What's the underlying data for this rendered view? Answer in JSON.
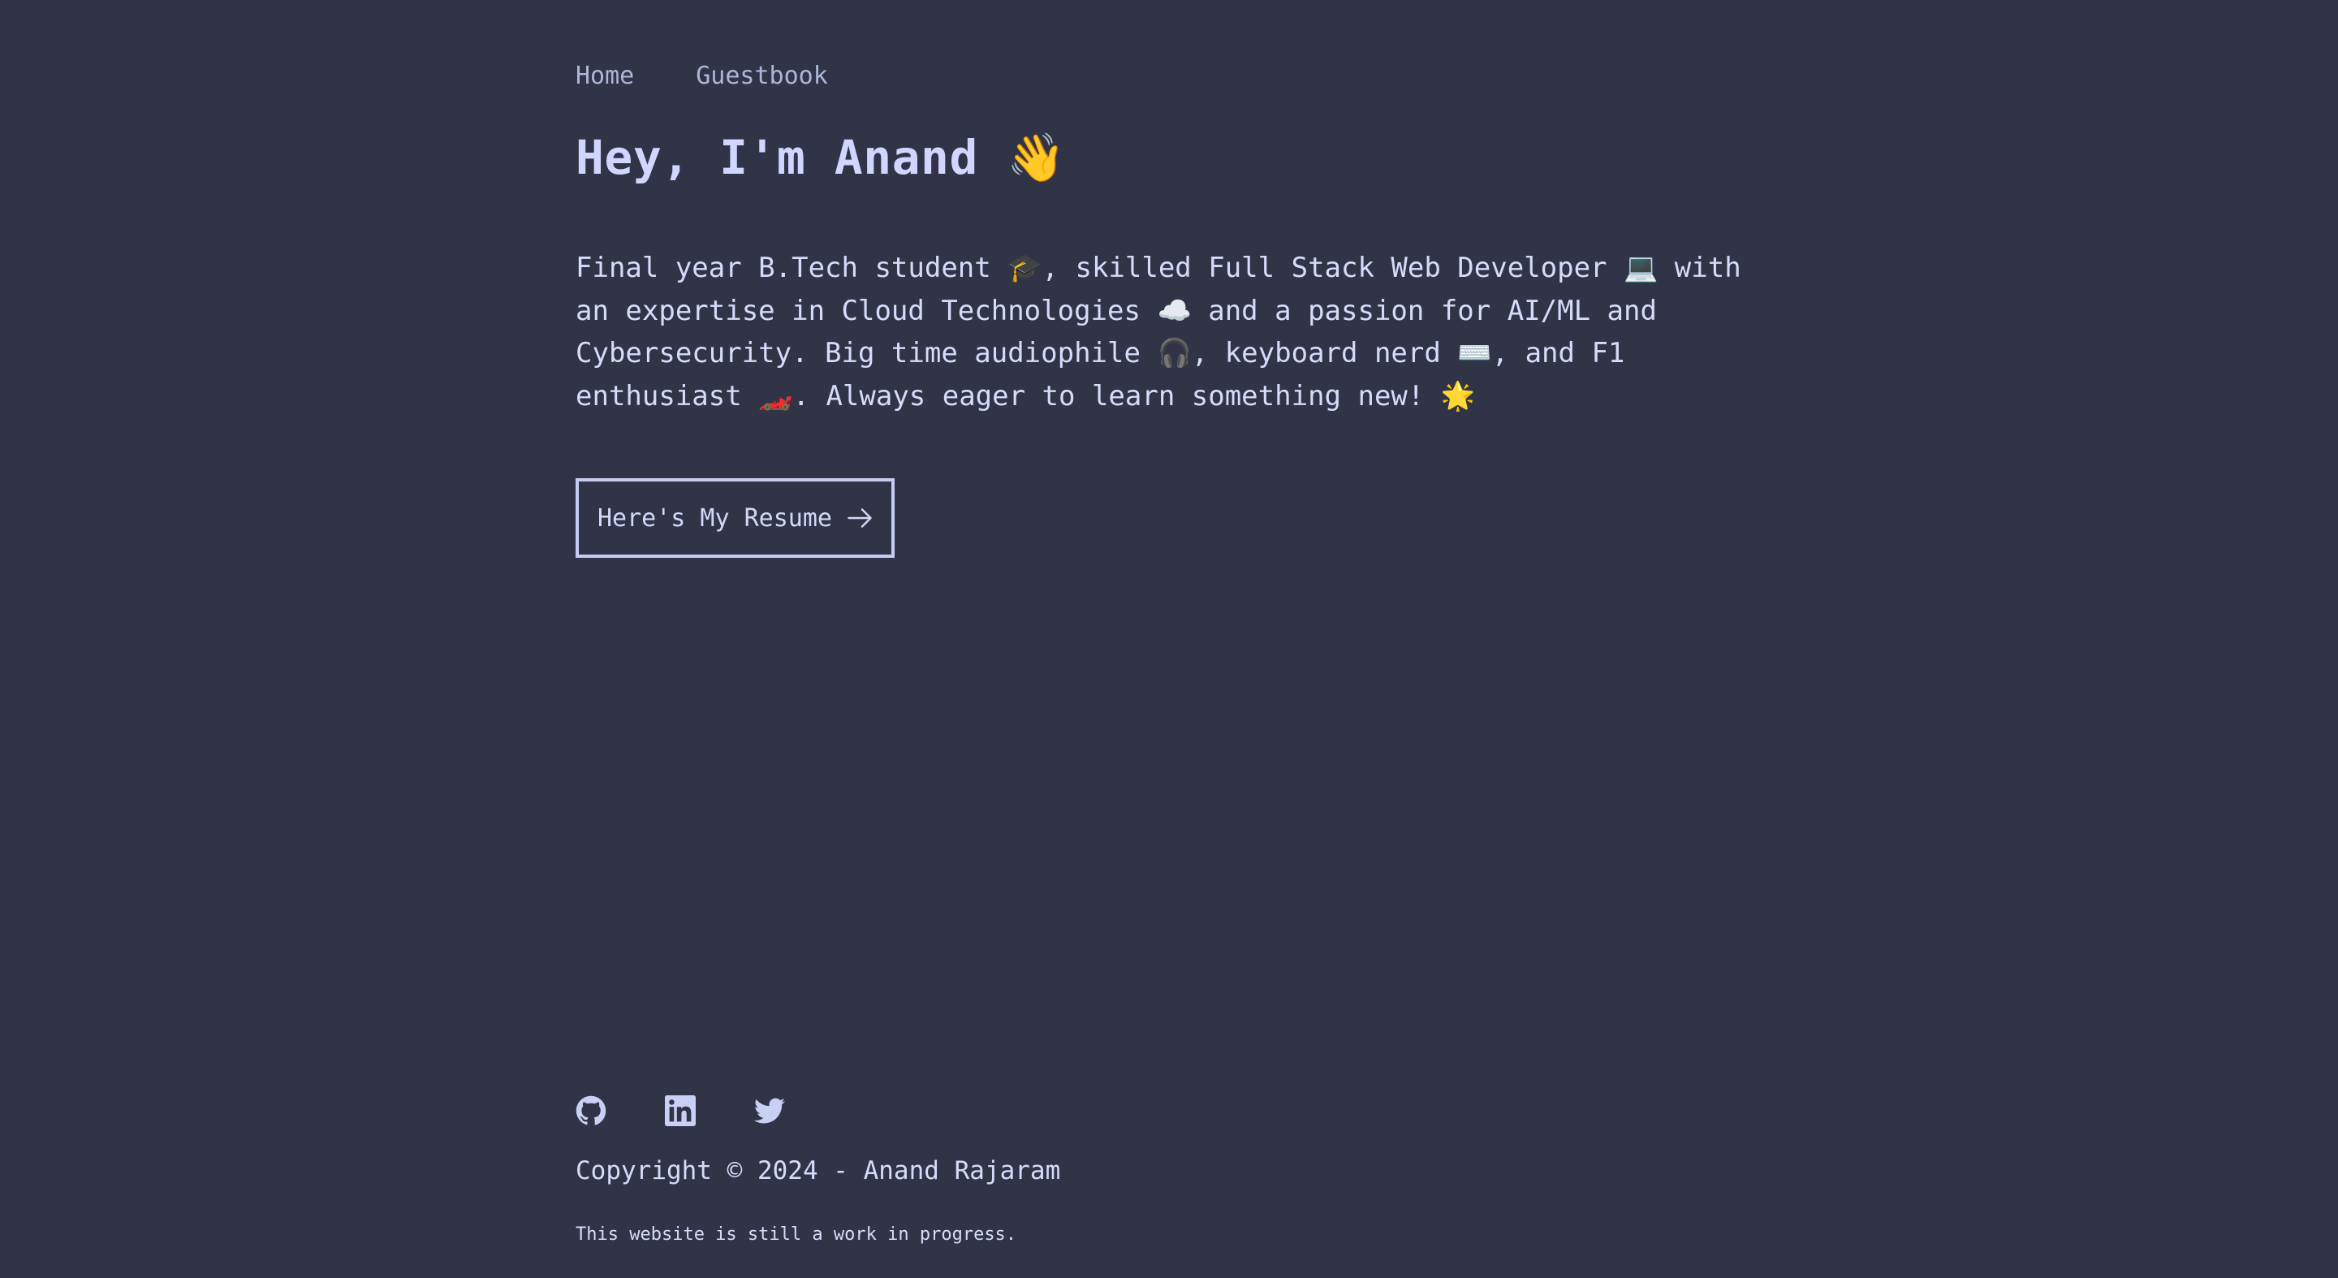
{
  "nav": {
    "items": [
      {
        "label": "Home"
      },
      {
        "label": "Guestbook"
      }
    ]
  },
  "hero": {
    "title": "Hey, I'm Anand 👋",
    "bio": "Final year B.Tech student 🎓, skilled Full Stack Web Developer 💻 with an expertise in Cloud Technologies ☁️ and a passion for AI/ML and Cybersecurity. Big time audiophile 🎧, keyboard nerd ⌨️, and F1 enthusiast 🏎️. Always eager to learn something new! 🌟",
    "resume_button": "Here's My Resume"
  },
  "footer": {
    "socials": [
      {
        "icon": "github-icon"
      },
      {
        "icon": "linkedin-icon"
      },
      {
        "icon": "twitter-icon"
      }
    ],
    "copyright": "Copyright © 2024 - Anand Rajaram",
    "note": "This website is still a work in progress."
  },
  "colors": {
    "background": "#313447",
    "text": "#c9d0f5",
    "accent": "#d0d6ff"
  }
}
